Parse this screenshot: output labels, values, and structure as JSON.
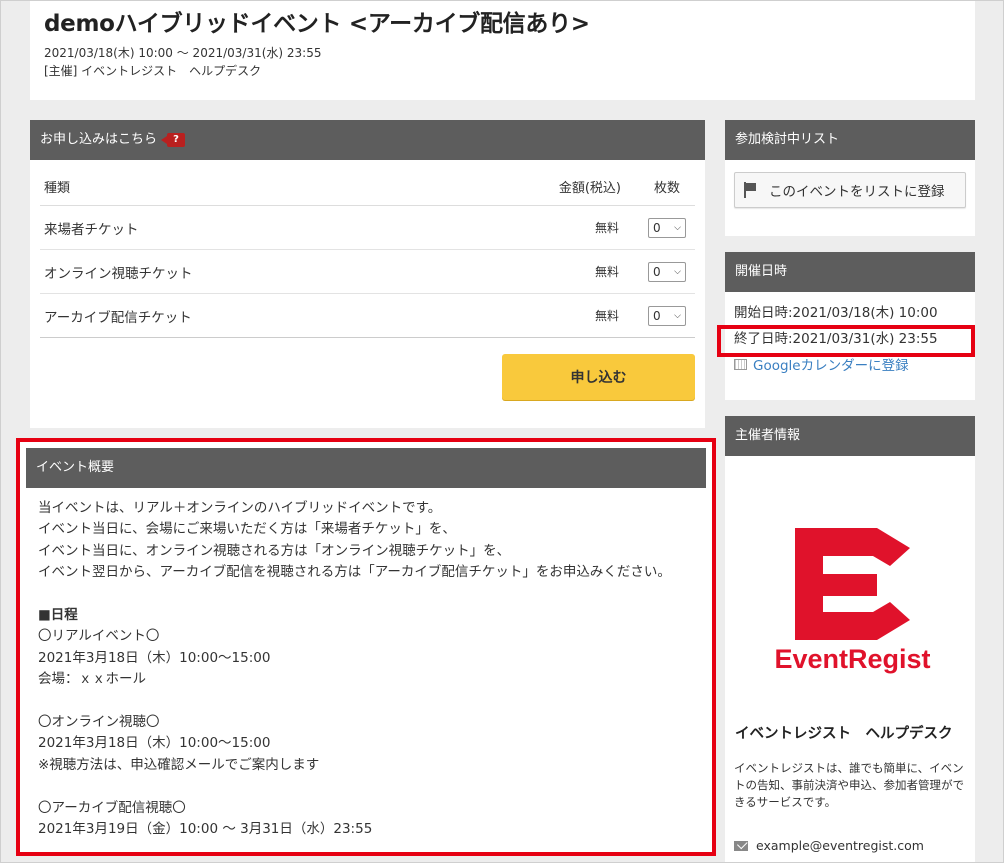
{
  "header": {
    "title": "demoハイブリッドイベント <アーカイブ配信あり>",
    "datetime": "2021/03/18(木) 10:00 ～ 2021/03/31(水) 23:55",
    "organizer": "[主催] イベントレジスト　ヘルプデスク"
  },
  "apply": {
    "title": "お申し込みはこちら",
    "help_icon": "?",
    "col_type": "種類",
    "col_price": "金額(税込)",
    "col_qty": "枚数",
    "tickets": [
      {
        "name": "来場者チケット",
        "price": "無料",
        "qty": "0"
      },
      {
        "name": "オンライン視聴チケット",
        "price": "無料",
        "qty": "0"
      },
      {
        "name": "アーカイブ配信チケット",
        "price": "無料",
        "qty": "0"
      }
    ],
    "button": "申し込む"
  },
  "overview": {
    "title": "イベント概要",
    "lines": [
      "当イベントは、リアル＋オンラインのハイブリッドイベントです。",
      "イベント当日に、会場にご来場いただく方は「来場者チケット」を、",
      "イベント当日に、オンライン視聴される方は「オンライン視聴チケット」を、",
      "イベント翌日から、アーカイブ配信を視聴される方は「アーカイブ配信チケット」をお申込みください。",
      "",
      "■日程",
      "〇リアルイベント〇",
      "2021年3月18日（木）10:00～15:00",
      "会場：ｘｘホール",
      "",
      "〇オンライン視聴〇",
      "2021年3月18日（木）10:00～15:00",
      "※視聴方法は、申込確認メールでご案内します",
      "",
      "〇アーカイブ配信視聴〇",
      "2021年3月19日（金）10:00 ～ 3月31日（水）23:55"
    ]
  },
  "watchlist": {
    "title": "参加検討中リスト",
    "button": "このイベントをリストに登録"
  },
  "dates": {
    "title": "開催日時",
    "start": "開始日時:2021/03/18(木) 10:00",
    "end": "終了日時:2021/03/31(水) 23:55",
    "gcal": "Googleカレンダーに登録"
  },
  "organizer": {
    "title": "主催者情報",
    "logo_text": "EventRegist",
    "name": "イベントレジスト　ヘルプデスク",
    "desc": "イベントレジストは、誰でも簡単に、イベントの告知、事前決済や申込、参加者管理ができるサービスです。",
    "email": "example@eventregist.com"
  },
  "colors": {
    "brand_red": "#e0122b",
    "highlight": "#e60012",
    "apply_button": "#f9c93c",
    "panel_header": "#5d5d5d",
    "link": "#3a7fc1"
  }
}
